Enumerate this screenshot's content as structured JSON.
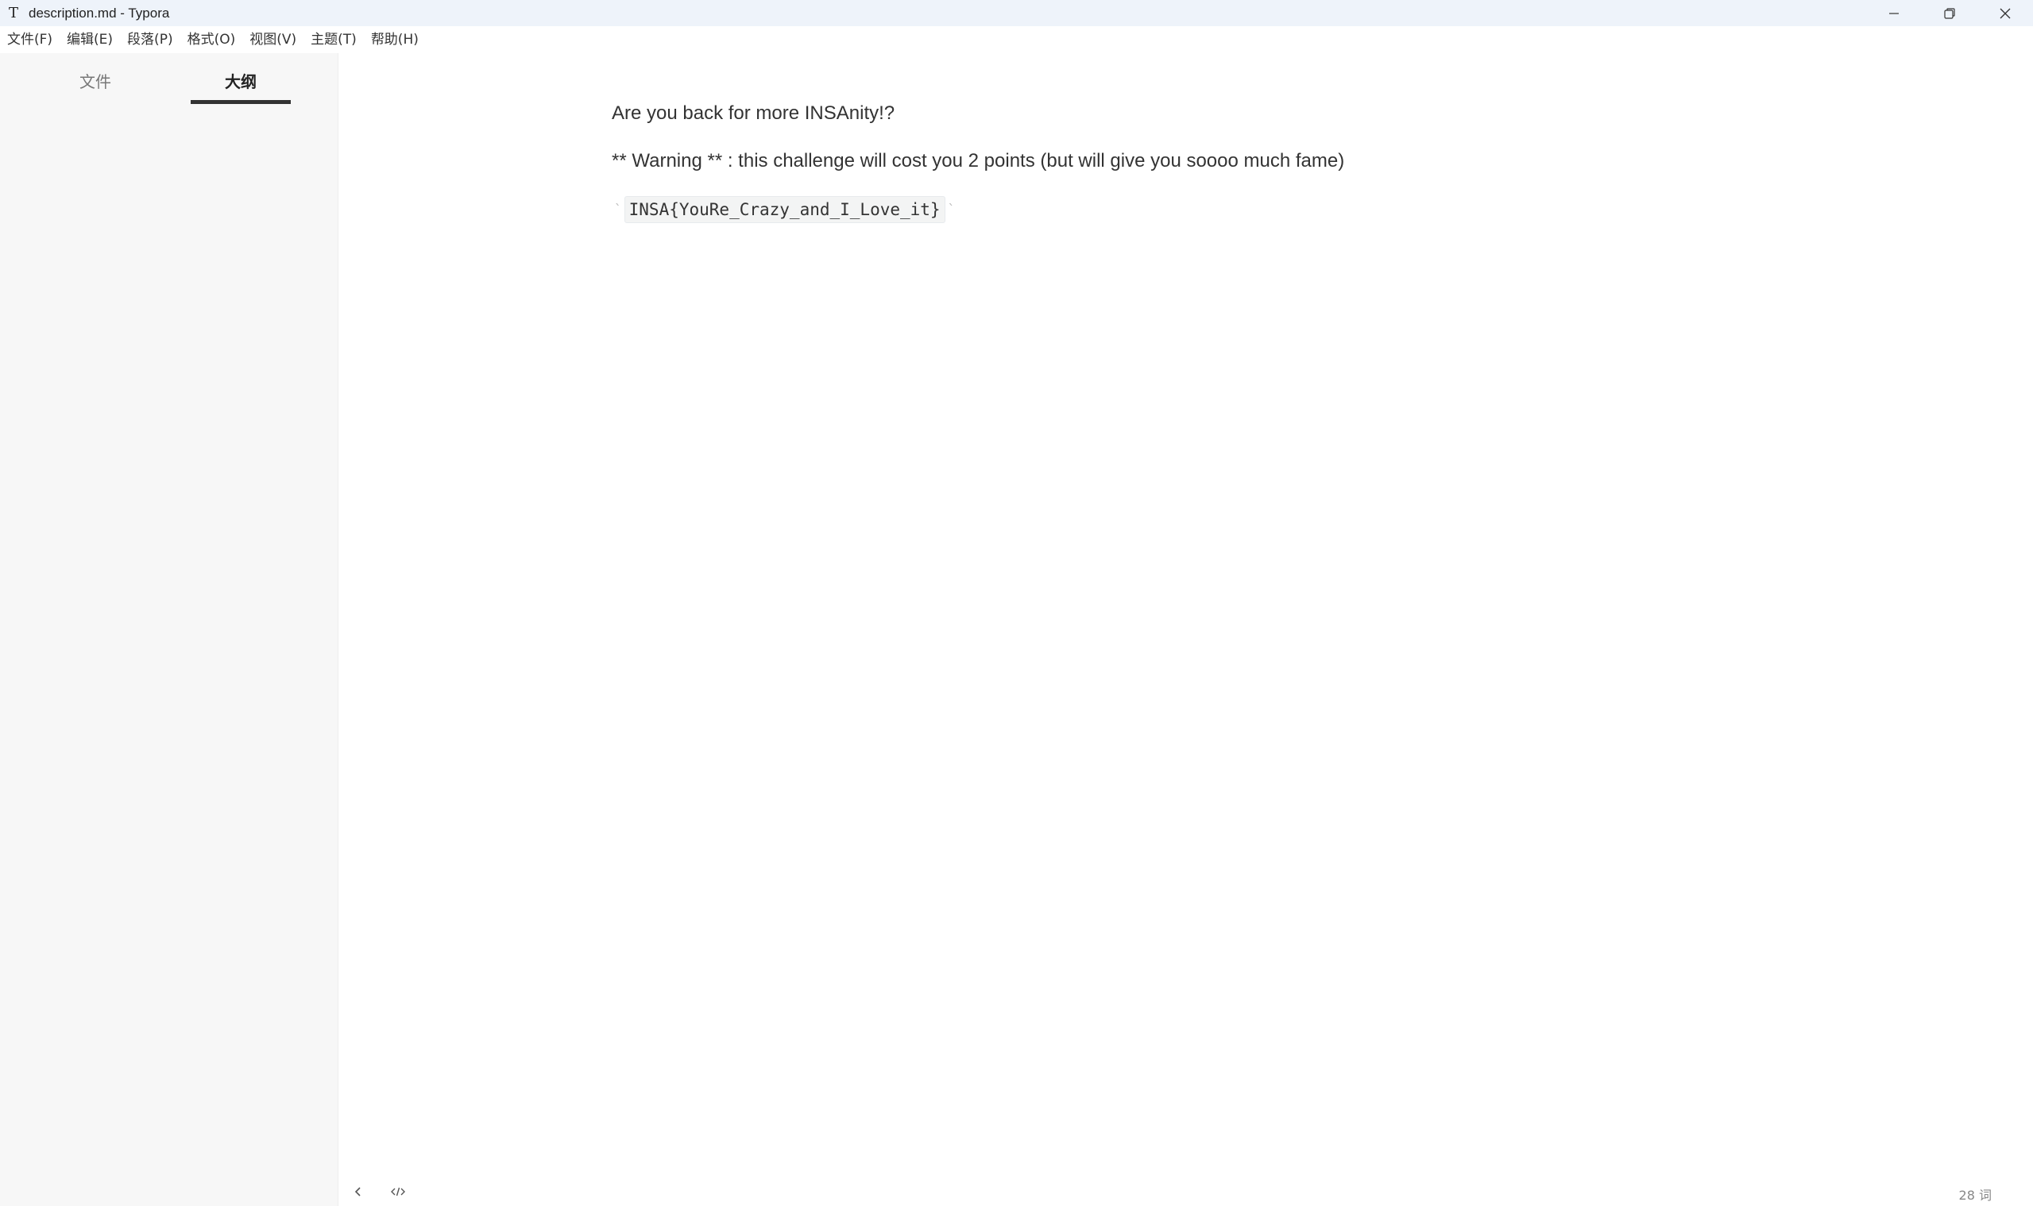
{
  "window": {
    "title": "description.md - Typora",
    "app_icon_glyph": "T"
  },
  "menu": {
    "items": [
      "文件(F)",
      "编辑(E)",
      "段落(P)",
      "格式(O)",
      "视图(V)",
      "主题(T)",
      "帮助(H)"
    ]
  },
  "sidebar": {
    "tabs": [
      {
        "label": "文件",
        "active": false
      },
      {
        "label": "大纲",
        "active": true
      }
    ]
  },
  "document": {
    "paragraph1": "Are you back for more INSAnity!?",
    "paragraph2": "** Warning ** : this challenge will cost you 2 points (but will give you soooo much fame)",
    "code_backtick": "`",
    "code": "INSA{YouRe_Crazy_and_I_Love_it}"
  },
  "footer": {
    "word_count": "28 词",
    "icons": [
      "chevron-left-icon",
      "source-code-icon"
    ]
  },
  "colors": {
    "titlebar_bg": "#eef3fa",
    "sidebar_bg": "#f7f7f7",
    "text": "#333333"
  }
}
